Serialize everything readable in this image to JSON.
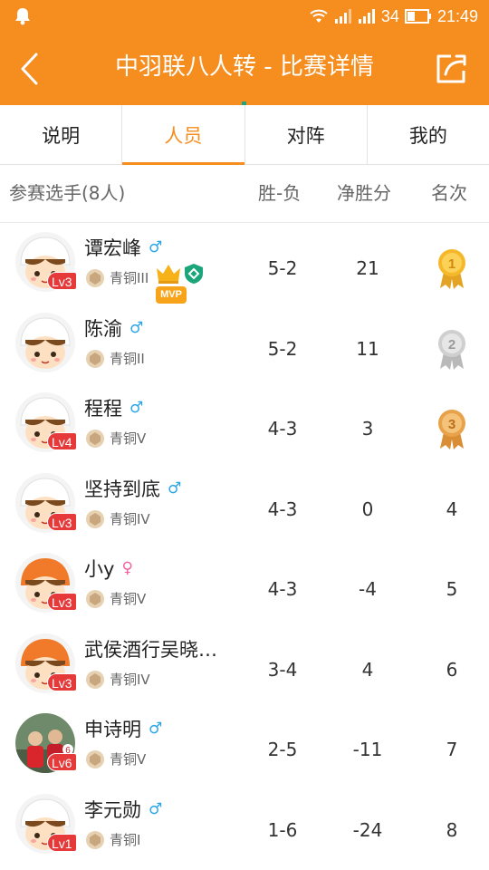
{
  "status_bar": {
    "signal_label": "34",
    "time": "21:49"
  },
  "header": {
    "title": "中羽联八人转 - 比赛详情"
  },
  "tabs": [
    {
      "label": "说明",
      "active": false
    },
    {
      "label": "人员",
      "active": true
    },
    {
      "label": "对阵",
      "active": false
    },
    {
      "label": "我的",
      "active": false
    }
  ],
  "columns": {
    "players": "参赛选手(8人)",
    "record": "胜-负",
    "net_points": "净胜分",
    "rank": "名次"
  },
  "players": [
    {
      "name": "谭宏峰",
      "gender": "♂",
      "level": "Lv3",
      "title": "青铜III",
      "record": "5-2",
      "net": "21",
      "rank": "1",
      "mvp": "MVP"
    },
    {
      "name": "陈渝",
      "gender": "♂",
      "level": "",
      "title": "青铜II",
      "record": "5-2",
      "net": "11",
      "rank": "2"
    },
    {
      "name": "程程",
      "gender": "♂",
      "level": "Lv4",
      "title": "青铜V",
      "record": "4-3",
      "net": "3",
      "rank": "3"
    },
    {
      "name": "坚持到底",
      "gender": "♂",
      "level": "Lv3",
      "title": "青铜IV",
      "record": "4-3",
      "net": "0",
      "rank": "4"
    },
    {
      "name": "小y",
      "gender": "♀",
      "level": "Lv3",
      "title": "青铜V",
      "record": "4-3",
      "net": "-4",
      "rank": "5"
    },
    {
      "name": "武侯酒行吴晓…",
      "gender": "",
      "level": "Lv3",
      "title": "青铜IV",
      "record": "3-4",
      "net": "4",
      "rank": "6"
    },
    {
      "name": "申诗明",
      "gender": "♂",
      "level": "Lv6",
      "title": "青铜V",
      "record": "2-5",
      "net": "-11",
      "rank": "7"
    },
    {
      "name": "李元勋",
      "gender": "♂",
      "level": "Lv1",
      "title": "青铜I",
      "record": "1-6",
      "net": "-24",
      "rank": "8"
    }
  ],
  "colors": {
    "brand": "#f58d1f",
    "level_badge": "#e5393a",
    "male": "#2aa6e6",
    "female": "#f062a2",
    "gold": "#f5b82a",
    "silver": "#c9c9c9",
    "bronze": "#e8a24a"
  },
  "icons": {
    "back": "back-arrow-icon",
    "share": "share-icon",
    "crown": "crown-icon",
    "shield": "shield-badge-icon",
    "rank_title": "bronze-rank-icon"
  }
}
